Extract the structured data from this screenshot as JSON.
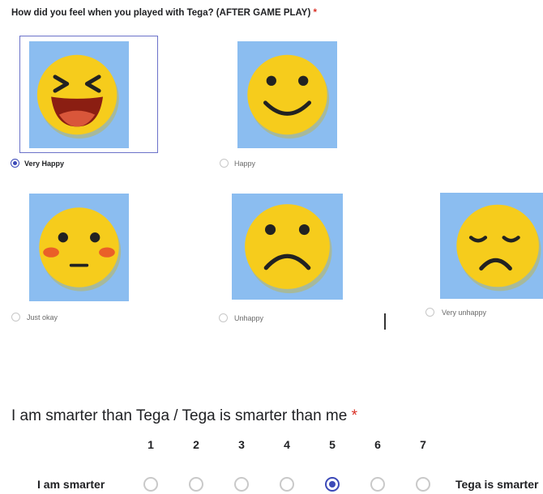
{
  "question1": {
    "text": "How did you feel when you played with Tega? (AFTER GAME PLAY)",
    "required_mark": "*",
    "options": [
      {
        "label": "Very Happy",
        "selected": true,
        "icon": "very-happy-face-icon"
      },
      {
        "label": "Happy",
        "selected": false,
        "icon": "happy-face-icon"
      },
      {
        "label": "Just okay",
        "selected": false,
        "icon": "just-okay-face-icon"
      },
      {
        "label": "Unhappy",
        "selected": false,
        "icon": "unhappy-face-icon"
      },
      {
        "label": "Very unhappy",
        "selected": false,
        "icon": "very-unhappy-face-icon"
      }
    ]
  },
  "question2": {
    "text": "I am smarter than Tega / Tega is smarter than me",
    "required_mark": "*",
    "scale": [
      "1",
      "2",
      "3",
      "4",
      "5",
      "6",
      "7"
    ],
    "low_label": "I am smarter",
    "high_label": "Tega is smarter",
    "selected": "5"
  },
  "colors": {
    "accent": "#3c4ab8",
    "required": "#d93025",
    "tile_bg": "#8bbdf0",
    "face": "#f6cc1c"
  }
}
